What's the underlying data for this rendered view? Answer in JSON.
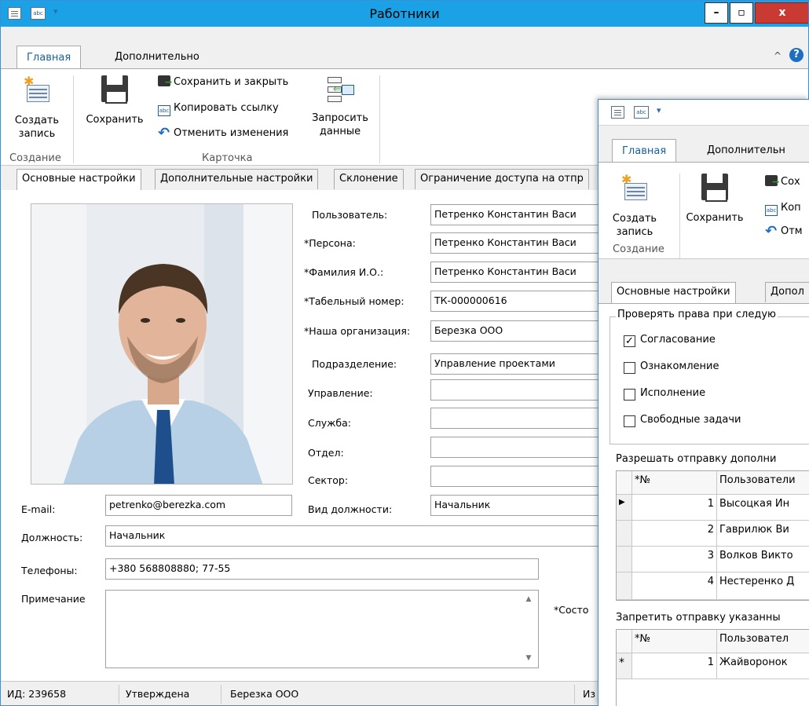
{
  "main": {
    "title": "Работники",
    "tabs": [
      "Главная",
      "Дополнительно"
    ],
    "ribbon": {
      "create_label": "Создать запись",
      "save_label": "Сохранить",
      "save_close": "Сохранить и закрыть",
      "copy_link": "Копировать ссылку",
      "undo": "Отменить изменения",
      "request_label": "Запросить данные",
      "group_create": "Создание",
      "group_card": "Карточка"
    },
    "form_tabs": [
      "Основные настройки",
      "Дополнительные настройки",
      "Склонение",
      "Ограничение доступа на отпр"
    ],
    "fields": {
      "user_label": "Пользователь:",
      "user_value": "Петренко Константин Васи",
      "person_label": "*Персона:",
      "person_value": "Петренко Константин Васи",
      "fio_label": "*Фамилия И.О.:",
      "fio_value": "Петренко Константин Васи",
      "tab_label": "*Табельный номер:",
      "tab_value": "ТК-000000616",
      "org_label": "*Наша организация:",
      "org_value": "Березка ООО",
      "div_label": "Подразделение:",
      "div_value": "Управление проектами",
      "dept_label": "Управление:",
      "dept_value": "",
      "svc_label": "Служба:",
      "svc_value": "",
      "otdel_label": "Отдел:",
      "otdel_value": "",
      "sector_label": "Сектор:",
      "sector_value": "",
      "email_label": "E-mail:",
      "email_value": "petrenko@berezka.com",
      "kind_label": "Вид должности:",
      "kind_value": "Начальник",
      "pos_label": "Должность:",
      "pos_value": "Начальник",
      "phone_label": "Телефоны:",
      "phone_value": "+380 568808880; 77-55",
      "note_label": "Примечание",
      "state_label": "*Состо"
    },
    "status": {
      "id": "ИД: 239658",
      "state": "Утверждена",
      "org": "Березка ООО",
      "extra": "Из"
    }
  },
  "second": {
    "tabs": [
      "Главная",
      "Дополнительн"
    ],
    "ribbon": {
      "create_label": "Создать запись",
      "save_label": "Сохранить",
      "save_close": "Сох",
      "copy_link": "Коп",
      "undo": "Отм",
      "group_create": "Создание"
    },
    "form_tabs": [
      "Основные настройки",
      "Допол"
    ],
    "check_group_title": "Проверять права при следую",
    "checks": [
      {
        "label": "Согласование",
        "checked": true
      },
      {
        "label": "Ознакомление",
        "checked": false
      },
      {
        "label": "Исполнение",
        "checked": false
      },
      {
        "label": "Свободные задачи",
        "checked": false
      }
    ],
    "allow_title": "Разрешать отправку дополни",
    "allow_headers": [
      "*№",
      "Пользователи"
    ],
    "allow_rows": [
      {
        "n": "1",
        "name": "Высоцкая Ин"
      },
      {
        "n": "2",
        "name": "Гаврилюк Ви"
      },
      {
        "n": "3",
        "name": "Волков Викто"
      },
      {
        "n": "4",
        "name": "Нестеренко Д"
      }
    ],
    "deny_title": "Запретить отправку указанны",
    "deny_headers": [
      "*№",
      "Пользовател"
    ],
    "deny_rows": [
      {
        "n": "1",
        "name": "Жайворонок"
      }
    ]
  }
}
